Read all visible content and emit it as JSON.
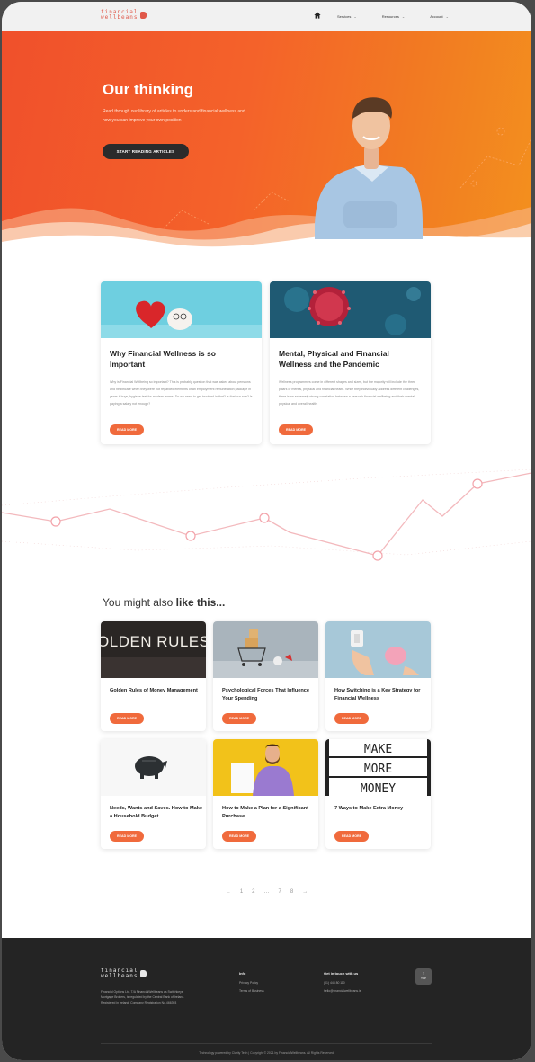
{
  "header": {
    "logo_line1": "financial",
    "logo_line2": "wellbeans",
    "nav": [
      {
        "label": "Services"
      },
      {
        "label": "Resources"
      },
      {
        "label": "Account"
      }
    ]
  },
  "hero": {
    "title": "Our thinking",
    "subtitle": "Read through our library of articles to understand financial wellness and how you can improve your own position",
    "cta": "START READING ARTICLES"
  },
  "featured": [
    {
      "title": "Why Financial Wellness is so Important",
      "excerpt": "Why is Financial Wellbeing so important? This is probably question that was asked about pensions and healthcare when they were not regarded elements of an employment remuneration package in years it buys, hygiene test for modern teams. Do we need to get involved in that? Is that our role? Is paying a salary not enough?",
      "button": "READ MORE"
    },
    {
      "title": "Mental, Physical and Financial Wellness and the Pandemic",
      "excerpt": "Wellness programmes come in different shapes and sizes, but the majority will include the three pillars of mental, physical and financial health. While they individually address different challenges, there is an extremely strong correlation between a person's financial wellbeing and their mental, physical and overall health.",
      "button": "READ MORE"
    }
  ],
  "related": {
    "heading_plain": "You might also ",
    "heading_bold": "like this...",
    "items": [
      {
        "title": "Golden Rules of Money Management",
        "button": "READ MORE",
        "image_text": "OLDEN RULES"
      },
      {
        "title": "Psychological Forces That Influence Your Spending",
        "button": "READ MORE"
      },
      {
        "title": "How Switching is a Key Strategy for Financial Wellness",
        "button": "READ MORE"
      },
      {
        "title": "Needs, Wants and Saves. How to Make a Household Budget",
        "button": "READ MORE"
      },
      {
        "title": "How to Make a Plan for a Significant Purchase",
        "button": "READ MORE"
      },
      {
        "title": "7 Ways to Make Extra Money",
        "button": "READ MORE",
        "image_lines": [
          "MAKE",
          "MORE",
          "MONEY"
        ]
      }
    ]
  },
  "pagination": {
    "prev": "←",
    "pages": [
      "1",
      "2",
      "…",
      "7",
      "8"
    ],
    "next": "→"
  },
  "footer": {
    "logo_line1": "financial",
    "logo_line2": "wellbeans",
    "description": "Financial Options Ltd. T/A FinancialWellbeans as Switchkeys Mortgage Brokers, is regulated by the Central Bank of Ireland. Registered in Ireland. Company Registration No.466393",
    "col1_title": "Info",
    "col1_links": [
      "Privacy Policy",
      "Terms of Business"
    ],
    "col2_title": "Get in touch with us",
    "col2_lines": [
      "(01) 443 80 110",
      "hello@financialwellbeans.ie"
    ],
    "top_label_arrow": "↑",
    "top_label": "TOP",
    "copyright": "Technology powered by Clarity Tech | Copyright © 2021 by FinancialWellbeans. All Rights Reserved."
  },
  "colors": {
    "accent": "#f06a3c",
    "hero_start": "#f0502b",
    "hero_end": "#f3901e",
    "dark": "#242424"
  }
}
